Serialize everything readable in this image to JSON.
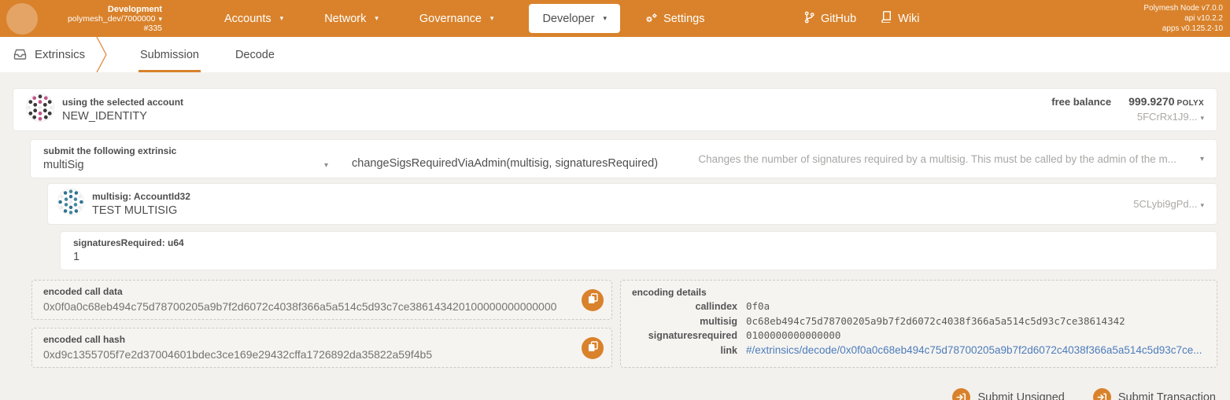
{
  "header": {
    "chain": {
      "name": "Development",
      "node": "polymesh_dev/7000000",
      "block": "#335"
    },
    "nav": [
      {
        "label": "Accounts"
      },
      {
        "label": "Network"
      },
      {
        "label": "Governance"
      },
      {
        "label": "Developer",
        "active": true
      },
      {
        "label": "Settings"
      }
    ],
    "links": [
      {
        "label": "GitHub",
        "icon": "git-branch-icon"
      },
      {
        "label": "Wiki",
        "icon": "book-icon"
      }
    ],
    "versions": [
      "Polymesh Node v7.0.0",
      "api v10.2.2",
      "apps v0.125.2-10"
    ]
  },
  "breadcrumb": {
    "section": "Extrinsics",
    "icon": "inbox-icon"
  },
  "tabs": [
    {
      "label": "Submission",
      "active": true
    },
    {
      "label": "Decode",
      "active": false
    }
  ],
  "account": {
    "label": "using the selected account",
    "value": "NEW_IDENTITY",
    "balance_label": "free balance",
    "balance_value": "999.9270",
    "balance_unit": "POLYX",
    "address_short": "5FCrRx1J9..."
  },
  "extrinsic": {
    "label": "submit the following extrinsic",
    "section": "multiSig",
    "method": "changeSigsRequiredViaAdmin(multisig, signaturesRequired)",
    "description": "Changes the number of signatures required by a multisig. This must be called by the admin of the m..."
  },
  "params": {
    "multisig": {
      "label": "multisig: AccountId32",
      "value": "TEST MULTISIG",
      "address_short": "5CLybi9gPd..."
    },
    "signatures_required": {
      "label": "signaturesRequired: u64",
      "value": "1"
    }
  },
  "outputs": {
    "call_data": {
      "label": "encoded call data",
      "value": "0x0f0a0c68eb494c75d78700205a9b7f2d6072c4038f366a5a514c5d93c7ce386143420100000000000000"
    },
    "call_hash": {
      "label": "encoded call hash",
      "value": "0xd9c1355705f7e2d37004601bdec3ce169e29432cffa1726892da35822a59f4b5"
    }
  },
  "encoding": {
    "title": "encoding details",
    "rows": [
      {
        "key": "callindex",
        "value": "0f0a"
      },
      {
        "key": "multisig",
        "value": "0c68eb494c75d78700205a9b7f2d6072c4038f366a5a514c5d93c7ce38614342"
      },
      {
        "key": "signaturesrequired",
        "value": "0100000000000000"
      },
      {
        "key": "link",
        "value": "#/extrinsics/decode/0x0f0a0c68eb494c75d78700205a9b7f2d6072c4038f366a5a514c5d93c7ce..."
      }
    ]
  },
  "actions": [
    {
      "label": "Submit Unsigned"
    },
    {
      "label": "Submit Transaction"
    }
  ],
  "colors": {
    "accent": "#d9822b",
    "link": "#4c7dbb",
    "header_bg": "#d9822b"
  }
}
